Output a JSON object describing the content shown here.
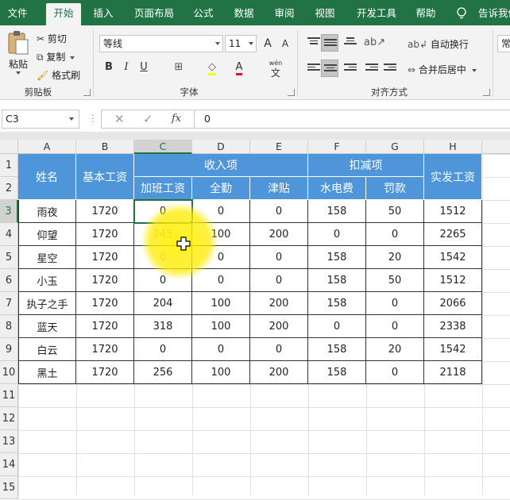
{
  "tabs": [
    {
      "label": "文件",
      "active": false
    },
    {
      "label": "开始",
      "active": true
    },
    {
      "label": "插入",
      "active": false
    },
    {
      "label": "页面布局",
      "active": false
    },
    {
      "label": "公式",
      "active": false
    },
    {
      "label": "数据",
      "active": false
    },
    {
      "label": "审阅",
      "active": false
    },
    {
      "label": "视图",
      "active": false
    },
    {
      "label": "开发工具",
      "active": false
    },
    {
      "label": "帮助",
      "active": false
    }
  ],
  "tell_me": "告诉我你",
  "clipboard": {
    "paste": "粘贴",
    "cut": "剪切",
    "copy": "复制",
    "format_painter": "格式刷",
    "group_label": "剪贴板"
  },
  "font": {
    "name": "等线",
    "size": "11",
    "grow": "A",
    "shrink": "A",
    "bold": "B",
    "italic": "I",
    "underline": "U",
    "font_color": "A",
    "wen": "wén",
    "wen_char": "文",
    "group_label": "字体"
  },
  "alignment": {
    "wrap_text": "自动换行",
    "merge_center": "合并后居中",
    "group_label": "对齐方式"
  },
  "number": {
    "format": "常"
  },
  "formula_bar": {
    "name_box": "C3",
    "fx": "fx",
    "value": "0"
  },
  "colors": {
    "ribbon_green": "#217346",
    "header_blue": "#4e95d9"
  },
  "columns": [
    "A",
    "B",
    "C",
    "D",
    "E",
    "F",
    "G",
    "H"
  ],
  "rows": [
    "1",
    "2",
    "3",
    "4",
    "5",
    "6",
    "7",
    "8",
    "9",
    "10",
    "11",
    "12",
    "13",
    "14",
    "15"
  ],
  "table": {
    "h_name": "姓名",
    "h_base": "基本工资",
    "h_income": "收入项",
    "h_deduct": "扣减项",
    "h_net": "实发工资",
    "h_overtime": "加班工资",
    "h_attend": "全勤",
    "h_allow": "津贴",
    "h_util": "水电费",
    "h_fine": "罚款",
    "body": [
      [
        "雨夜",
        "1720",
        "0",
        "0",
        "0",
        "158",
        "50",
        "1512"
      ],
      [
        "仰望",
        "1720",
        "245",
        "100",
        "200",
        "0",
        "0",
        "2265"
      ],
      [
        "星空",
        "1720",
        "0",
        "0",
        "0",
        "158",
        "20",
        "1542"
      ],
      [
        "小玉",
        "1720",
        "0",
        "0",
        "0",
        "158",
        "50",
        "1512"
      ],
      [
        "执子之手",
        "1720",
        "204",
        "100",
        "200",
        "158",
        "0",
        "2066"
      ],
      [
        "蓝天",
        "1720",
        "318",
        "100",
        "200",
        "0",
        "0",
        "2338"
      ],
      [
        "白云",
        "1720",
        "0",
        "0",
        "0",
        "158",
        "20",
        "1542"
      ],
      [
        "黑土",
        "1720",
        "256",
        "100",
        "200",
        "158",
        "0",
        "2118"
      ]
    ]
  }
}
